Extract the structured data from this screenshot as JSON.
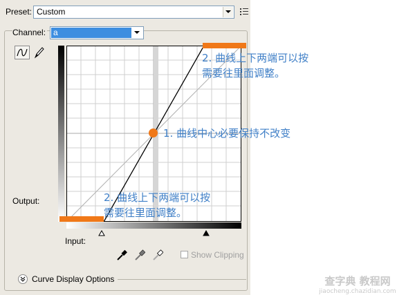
{
  "preset": {
    "label": "Preset:",
    "value": "Custom"
  },
  "channel": {
    "label": "Channel:",
    "value": "a"
  },
  "graph": {
    "output_label": "Output:",
    "input_label": "Input:"
  },
  "show_clipping": {
    "label": "Show Clipping",
    "checked": false,
    "enabled": false
  },
  "curve_display_options": {
    "label": "Curve Display Options"
  },
  "annotations": {
    "top_right_line1": "2. 曲线上下两端可以按",
    "top_right_line2": "需要往里面调整。",
    "center": "1. 曲线中心必要保持不改变",
    "bottom_left_line1": "2. 曲线上下两端可以按",
    "bottom_left_line2": "需要往里面调整。"
  },
  "watermark": {
    "line1": "查字典 教程网",
    "line2": "jiaocheng.chazidian.com"
  },
  "colors": {
    "marker": "#f07818",
    "annotation_text": "#3f7fc7",
    "panel_bg": "#ece9e2",
    "channel_highlight": "#3d8ee0"
  },
  "icons": [
    "panel-menu-icon",
    "curve-tool-icon",
    "pencil-icon",
    "black-eyedropper-icon",
    "gray-eyedropper-icon",
    "white-eyedropper-icon",
    "chevron-down-icon"
  ]
}
